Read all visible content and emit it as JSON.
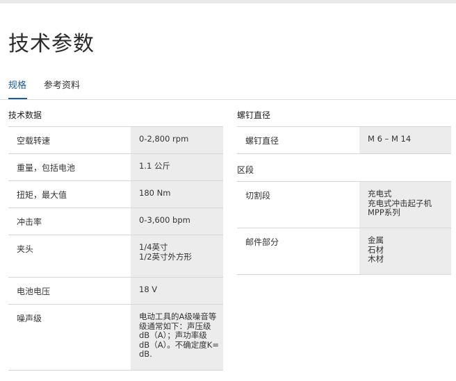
{
  "page": {
    "title": "技术参数"
  },
  "tabs": [
    {
      "label": "规格",
      "active": true
    },
    {
      "label": "参考资料",
      "active": false
    }
  ],
  "specs": {
    "title": "技术数据",
    "rows": [
      {
        "label": "空载转速",
        "value": "0-2,800 rpm"
      },
      {
        "label": "重量，包括电池",
        "value": "1.1 公斤"
      },
      {
        "label": "扭矩，最大值",
        "value": "180 Nm"
      },
      {
        "label": "冲击率",
        "value": "0-3,600 bpm"
      },
      {
        "label": "夹头",
        "value": "1/4英寸\n1/2英寸外方形"
      },
      {
        "label": "电池电压",
        "value": "18 V"
      },
      {
        "label": "噪声级",
        "value": "电动工具的A级噪音等\n级通常如下：声压级\ndB（A）；声功率级\ndB（A）。不确定度K=\ndB."
      }
    ]
  },
  "screw": {
    "title": "螺钉直径",
    "rows": [
      {
        "label": "螺钉直径",
        "value": "M 6 – M 14"
      }
    ]
  },
  "segment": {
    "title": "区段",
    "rows": [
      {
        "label": "切割段",
        "value": "充电式\n充电式冲击起子机\nMPP系列"
      },
      {
        "label": "邮件部分",
        "value": "金属\n石材\n木材"
      }
    ]
  }
}
